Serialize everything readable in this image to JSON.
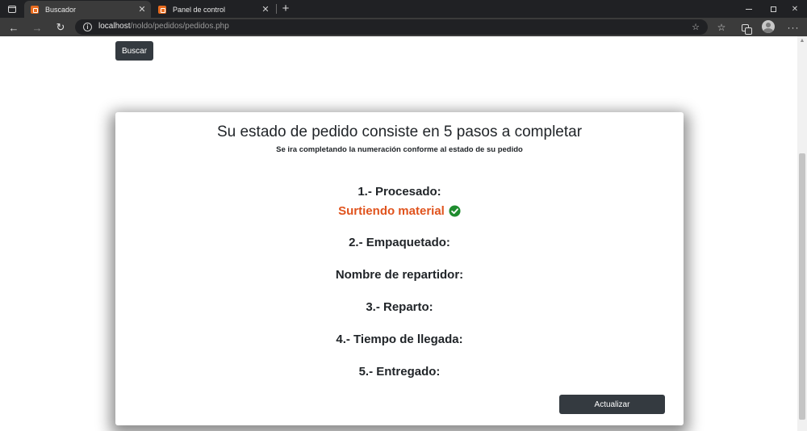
{
  "browser": {
    "tabs": [
      {
        "label": "Buscador",
        "active": true
      },
      {
        "label": "Panel de control",
        "active": false
      }
    ],
    "address": {
      "host": "localhost",
      "path": "/noldo/pedidos/pedidos.php"
    }
  },
  "page": {
    "search_button": "Buscar",
    "card": {
      "title": "Su estado de pedido consiste en 5 pasos a completar",
      "subtitle": "Se ira completando la numeración conforme al estado de su pedido",
      "steps": {
        "s1": "1.- Procesado:",
        "s1_status": "Surtiendo material",
        "s2": "2.- Empaquetado:",
        "repartidor": "Nombre de repartidor:",
        "s3": "3.- Reparto:",
        "s4": "4.- Tiempo de llegada:",
        "s5": "5.- Entregado:"
      },
      "update_button": "Actualizar"
    }
  },
  "colors": {
    "status_text": "#e0531d",
    "check_icon": "#1e8c2e",
    "button_bg": "#343a40"
  },
  "icons": {
    "check": "check-circle-icon"
  }
}
